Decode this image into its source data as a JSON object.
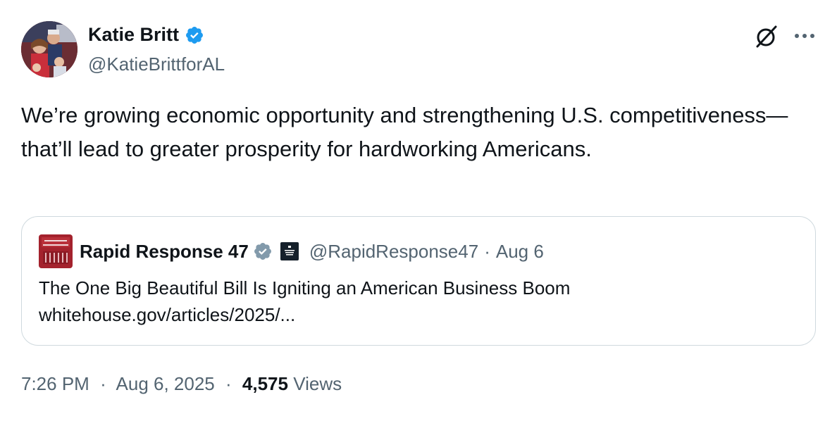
{
  "author": {
    "display_name": "Katie Britt",
    "handle": "@KatieBrittforAL",
    "verified_color": "#1d9bf0",
    "avatar_icon": "profile-photo"
  },
  "actions": {
    "grok_icon": "grok-icon",
    "more_icon": "more-icon"
  },
  "tweet": {
    "text": "We’re growing economic opportunity and strengthening U.S. competitiveness—that’ll lead to greater prosperity for hardworking Americans."
  },
  "quote": {
    "display_name": "Rapid Response 47",
    "handle": "@RapidResponse47",
    "separator": "·",
    "date": "Aug 6",
    "verified_color": "#829aab",
    "title": "The One Big Beautiful Bill Is Igniting an American Business Boom",
    "link": "whitehouse.gov/articles/2025/..."
  },
  "meta": {
    "time": "7:26 PM",
    "sep1": "·",
    "date": "Aug 6, 2025",
    "sep2": "·",
    "views_count": "4,575",
    "views_label": "Views"
  },
  "colors": {
    "text_primary": "#0f1419",
    "text_secondary": "#536471",
    "border": "#cfd9de"
  }
}
